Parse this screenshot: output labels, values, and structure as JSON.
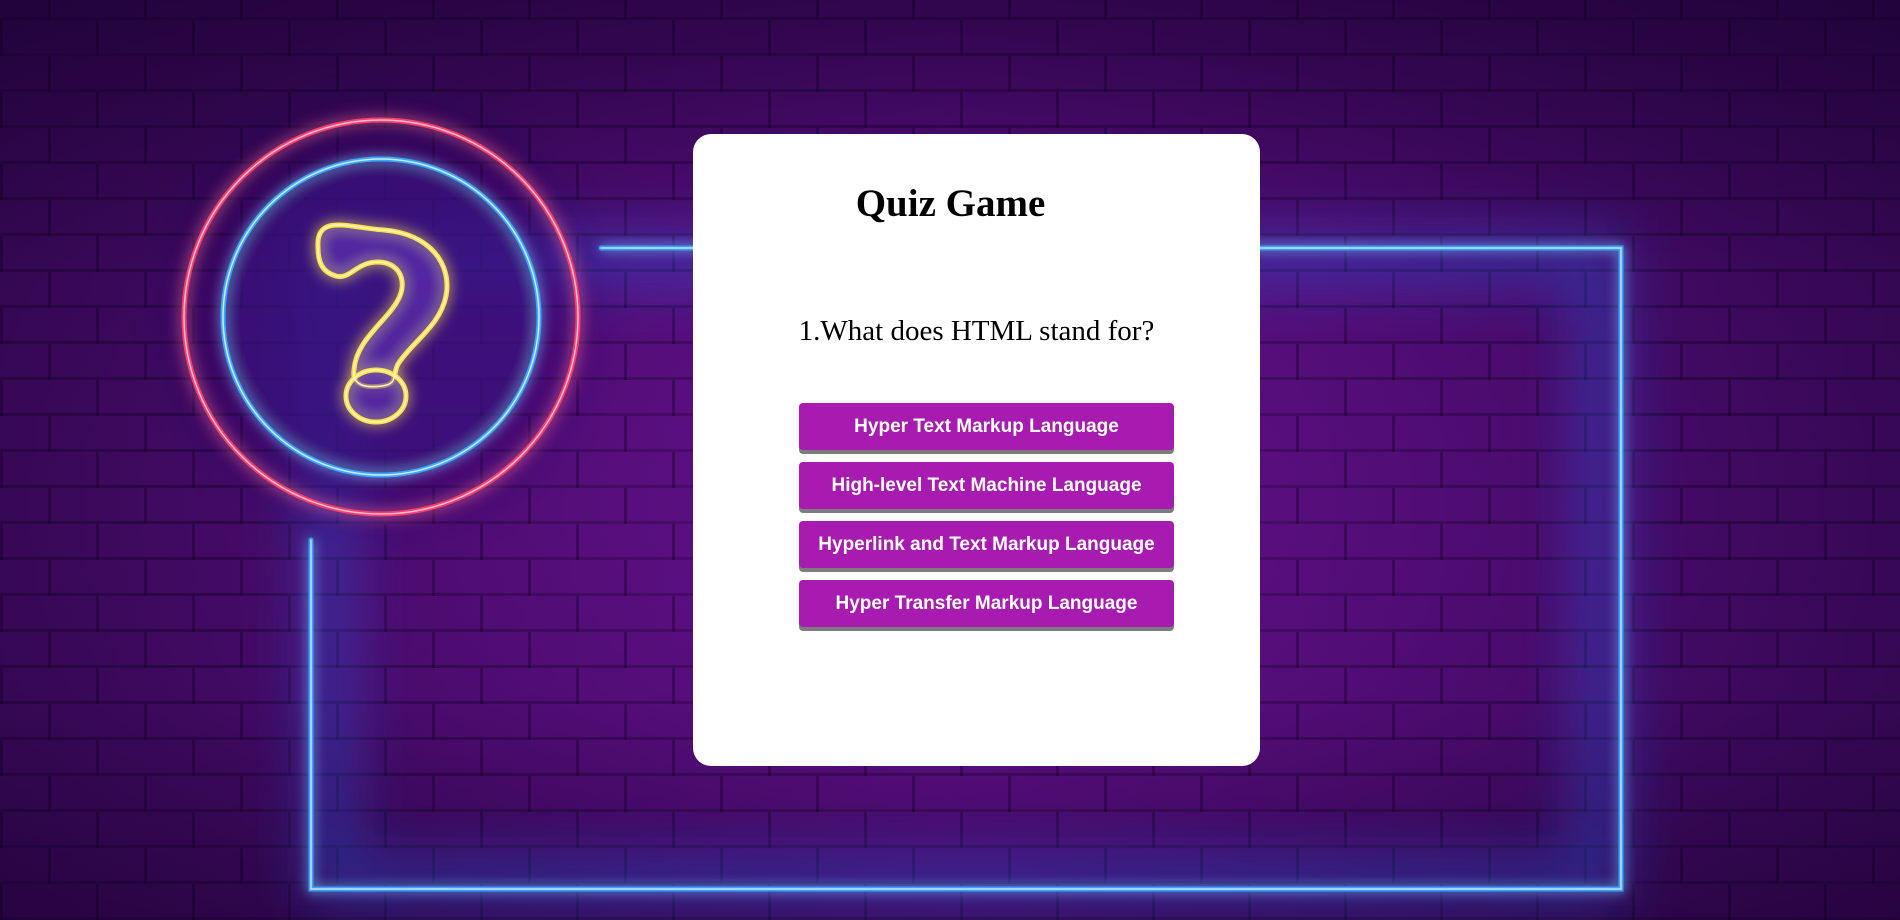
{
  "quiz": {
    "title": "Quiz Game",
    "question": "1.What does HTML stand for?",
    "answers": [
      "Hyper Text Markup Language",
      "High-level Text Machine Language",
      "Hyperlink and Text Markup Language",
      "Hyper Transfer Markup Language"
    ]
  },
  "background": {
    "decoration": "question-mark-icon",
    "colors": {
      "outer_ring": "#ff3d6e",
      "inner_ring": "#3ea8ff",
      "question_mark": "#ffe14a",
      "frame": "#3aa0ff",
      "wall": "#4a0c6e"
    }
  },
  "theme": {
    "card_bg": "#ffffff",
    "button_bg": "#a71bb1",
    "button_text": "#ffffff",
    "button_shadow": "#7d7d7d"
  }
}
